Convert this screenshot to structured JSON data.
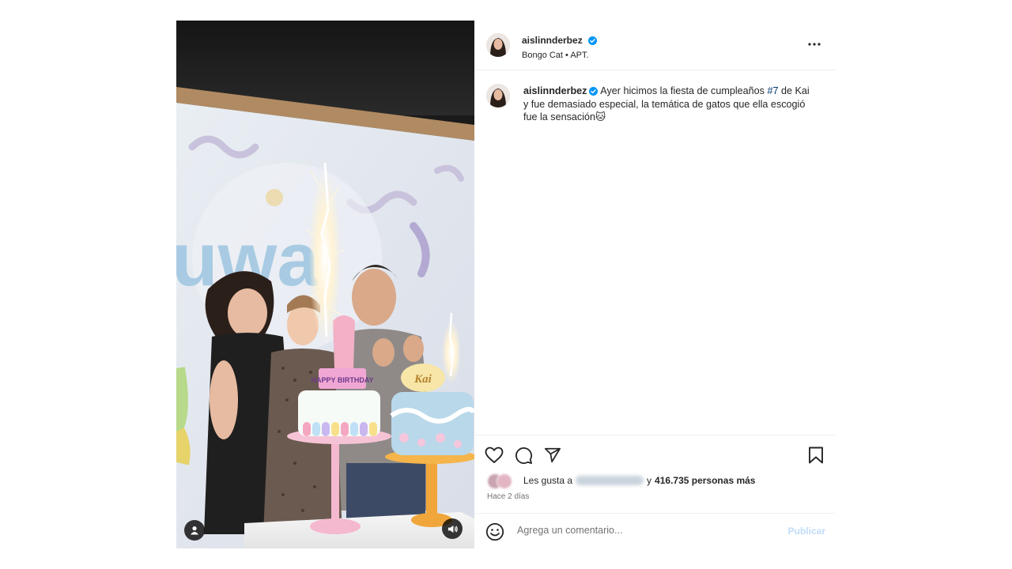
{
  "post": {
    "username": "aislinnderbez",
    "verified": true,
    "audio": "Bongo Cat • APT.",
    "caption": {
      "text_before": "Ayer hicimos la fiesta de cumpleaños ",
      "hashtag": "#7",
      "text_after": " de Kai y fue demasiado especial, la temática de gatos que ella escogió fue la sensación",
      "emoji": "🐱"
    },
    "likes": {
      "prefix": "Les gusta a",
      "middle": "y",
      "count_text": "416.735 personas más"
    },
    "timestamp": "Hace 2 días"
  },
  "comment": {
    "placeholder": "Agrega un comentario...",
    "publish_label": "Publicar"
  },
  "media": {
    "cake_topper_text": "HAPPY BIRTHDAY",
    "cake_name_text": "Kai"
  },
  "icons": [
    "user-tag-icon",
    "volume-icon",
    "more-options-icon",
    "heart-icon",
    "comment-icon",
    "share-icon",
    "bookmark-icon",
    "emoji-icon",
    "verified-icon"
  ],
  "colors": {
    "verified": "#0095f6",
    "hashtag": "#00376b",
    "publish_disabled": "#c1dcf7",
    "muted": "#737373"
  }
}
